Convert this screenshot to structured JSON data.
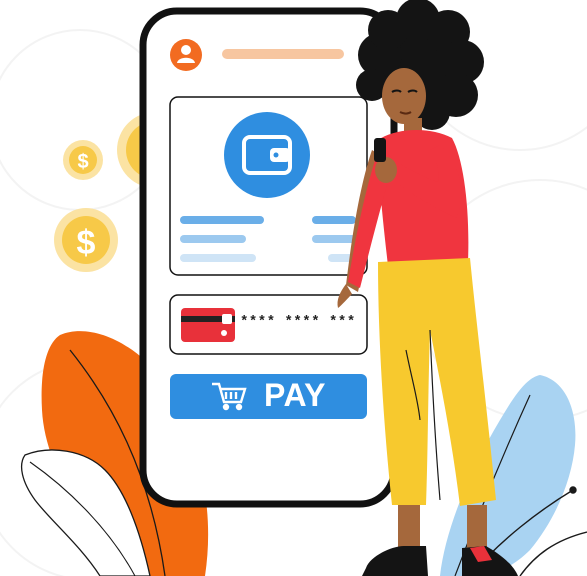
{
  "payment": {
    "card_number_masked": "**** **** ***",
    "pay_label": "PAY"
  },
  "icons": {
    "profile": "user-icon",
    "wallet": "wallet-icon",
    "card": "credit-card-icon",
    "cart": "shopping-cart-icon",
    "coins": "dollar-coin-icon"
  },
  "colors": {
    "accent_blue": "#2f8ee0",
    "card_red": "#e8313a",
    "profile_orange": "#f26b21",
    "coin_gold": "#f7c948",
    "leaf_orange": "#f26a10",
    "leaf_blue": "#a9d3f2",
    "shirt_red": "#f0353f",
    "pants_yellow": "#f7c92e",
    "skin": "#a5683c",
    "hair": "#141414"
  }
}
